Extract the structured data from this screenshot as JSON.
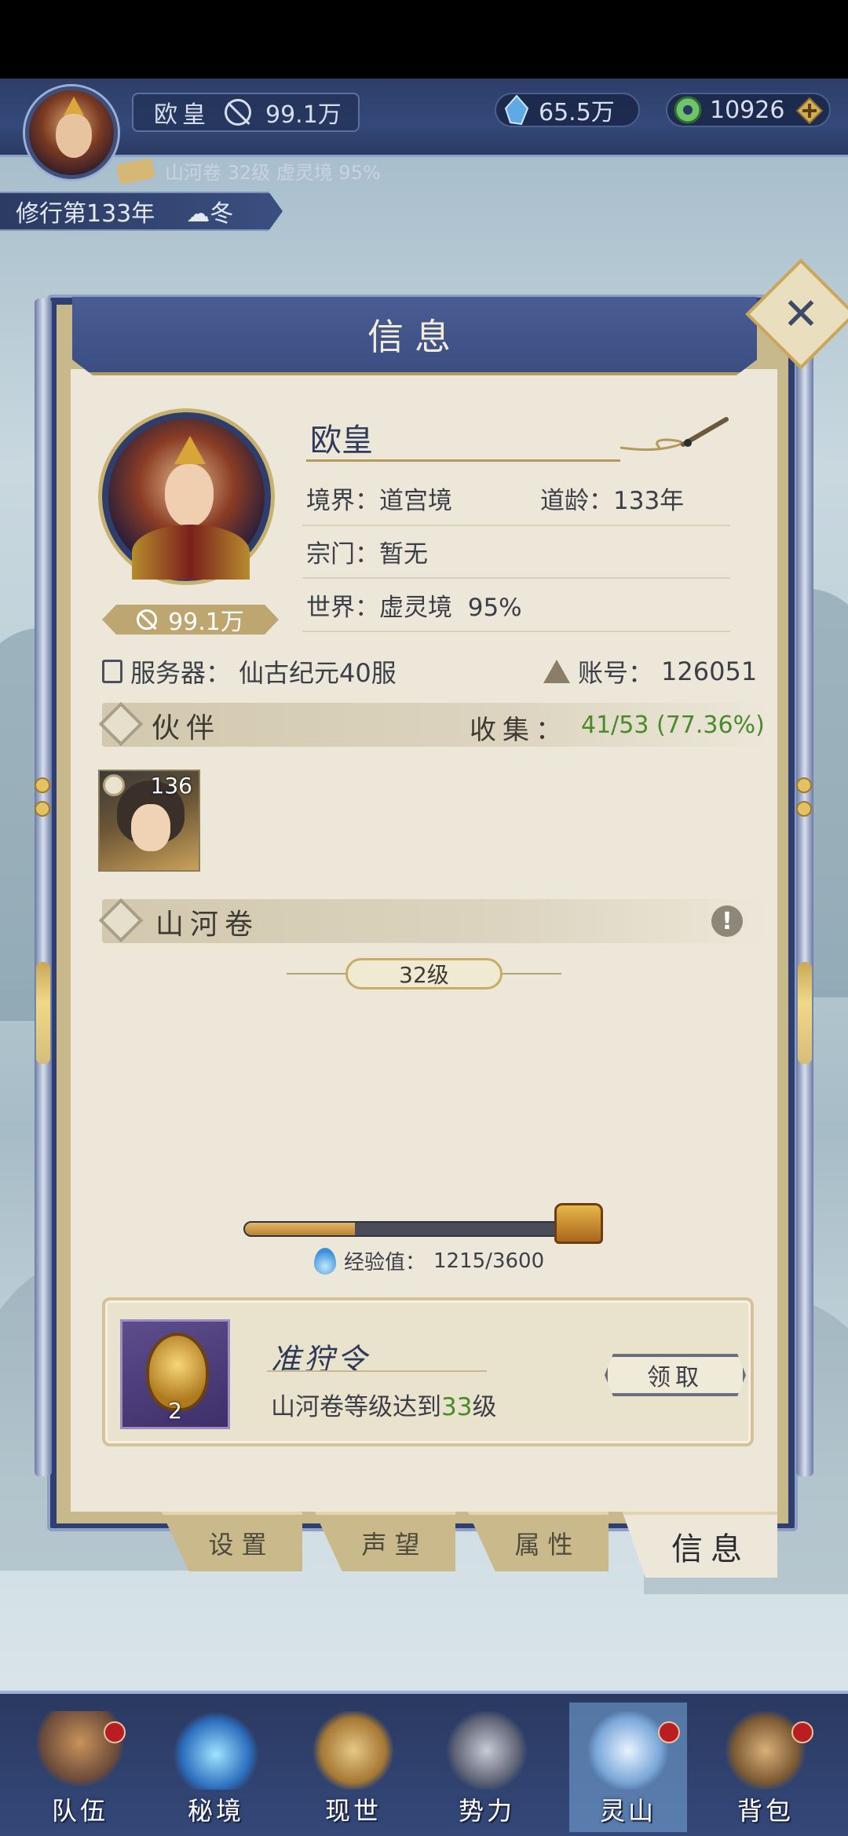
{
  "player": {
    "name": "欧皇",
    "power": "99.1万",
    "spirit_stones": "65.5万",
    "jade": "10926",
    "sub_info": "山河卷 32级 虚灵境 95%",
    "year": "修行第133年",
    "season": "冬"
  },
  "panel": {
    "title": "信息",
    "name": "欧皇",
    "realm_label": "境界：",
    "realm_value": "道宫境",
    "age_label": "道龄：",
    "age_value": "133年",
    "sect_label": "宗门：",
    "sect_value": "暂无",
    "world_label": "世界：",
    "world_value": "虚灵境",
    "world_progress": "95%",
    "power": "99.1万",
    "server_label": "服务器：",
    "server_value": "仙古纪元40服",
    "account_label": "账号：",
    "account_value": "126051"
  },
  "partners": {
    "title": "伙伴",
    "collect_label": "收集：",
    "collect_value": "41/53 (77.36%)",
    "items": [
      {
        "level": "136"
      }
    ]
  },
  "shanhe": {
    "title": "山河卷",
    "level": "32级",
    "exp_label": "经验值：",
    "exp_value": "1215/3600",
    "exp_fraction": 0.3375
  },
  "reward": {
    "name": "准狩令",
    "desc_prefix": "山河卷等级达到",
    "desc_level": "33",
    "desc_suffix": "级",
    "count": "2",
    "claim_label": "领取"
  },
  "tabs": [
    {
      "label": "设置",
      "active": false
    },
    {
      "label": "声望",
      "active": false
    },
    {
      "label": "属性",
      "active": false
    },
    {
      "label": "信息",
      "active": true
    }
  ],
  "nav": [
    {
      "label": "队伍",
      "icon": "party-icon",
      "badge": true
    },
    {
      "label": "秘境",
      "icon": "secret-realm-icon",
      "badge": false
    },
    {
      "label": "现世",
      "icon": "world-icon",
      "badge": false
    },
    {
      "label": "势力",
      "icon": "faction-icon",
      "badge": false
    },
    {
      "label": "灵山",
      "icon": "spirit-mountain-icon",
      "badge": true,
      "active": true
    },
    {
      "label": "背包",
      "icon": "backpack-icon",
      "badge": true
    }
  ],
  "colors": {
    "navy": "#34497a",
    "paper": "#ece7d9",
    "gold": "#c7ae66",
    "green_text": "#4a8a2a",
    "badge_red": "#b81e22"
  }
}
